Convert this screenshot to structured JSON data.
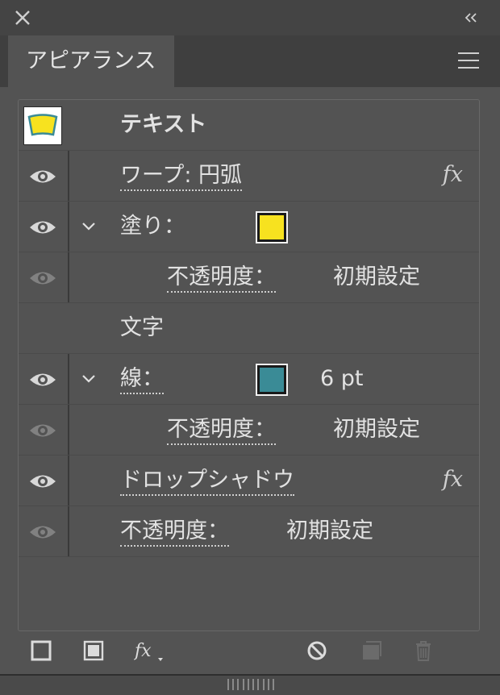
{
  "tab": {
    "label": "アピアランス"
  },
  "target": {
    "label": "テキスト"
  },
  "rows": [
    {
      "label": "ワープ: 円弧"
    },
    {
      "label": "塗り："
    },
    {
      "label": "不透明度：",
      "value": "初期設定"
    },
    {
      "label": "文字"
    },
    {
      "label": "線：",
      "value": "6 pt"
    },
    {
      "label": "不透明度：",
      "value": "初期設定"
    },
    {
      "label": "ドロップシャドウ"
    },
    {
      "label": "不透明度：",
      "value": "初期設定"
    }
  ],
  "fx_symbol": "fx",
  "colors": {
    "fill_swatch": "#f7e21f",
    "stroke_swatch": "#3a8b96",
    "thumb_fill": "#f7e21f",
    "thumb_stroke": "#3a8b96"
  }
}
